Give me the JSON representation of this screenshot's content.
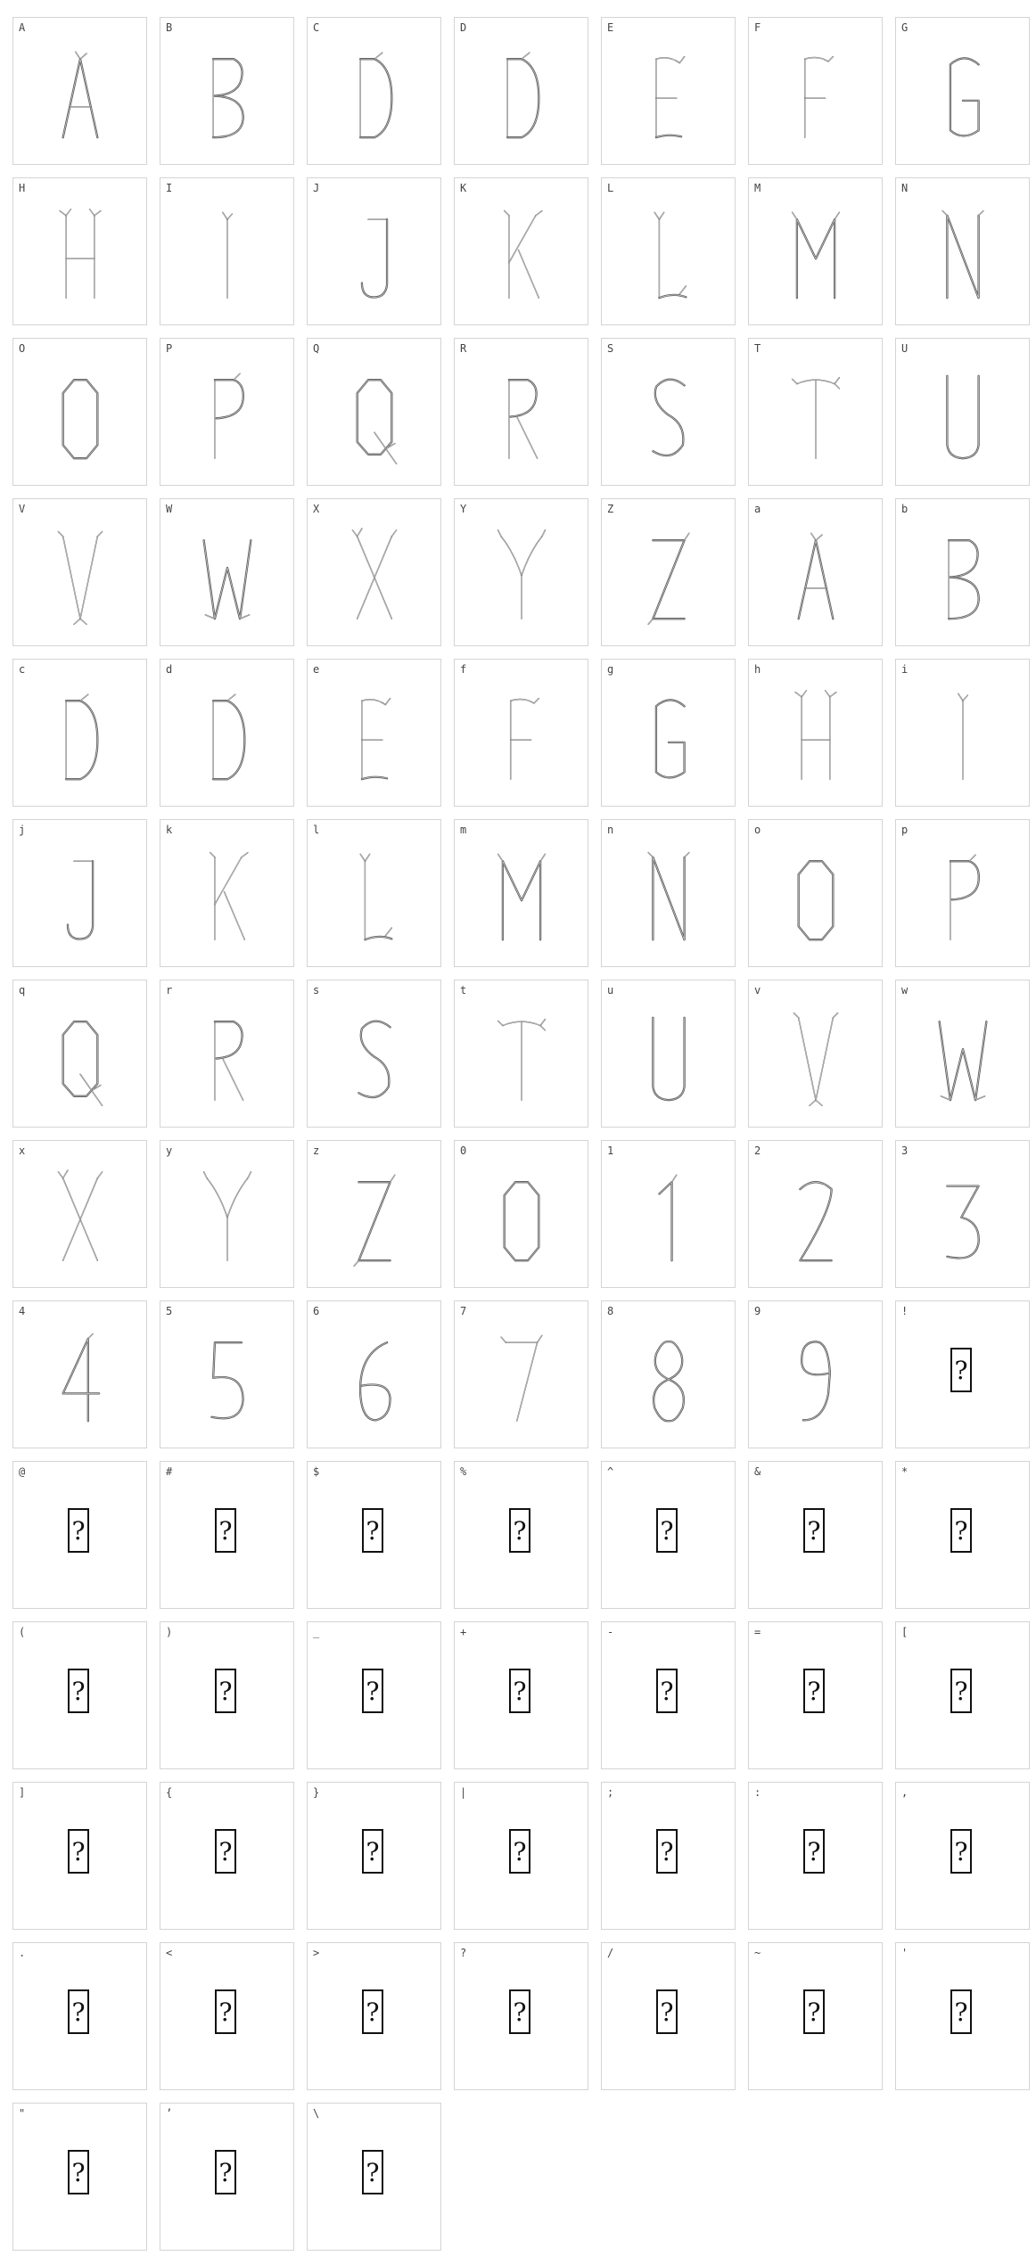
{
  "cells": [
    {
      "label": "A",
      "glyph": "A",
      "missing": false
    },
    {
      "label": "B",
      "glyph": "B",
      "missing": false
    },
    {
      "label": "C",
      "glyph": "D",
      "missing": false
    },
    {
      "label": "D",
      "glyph": "D",
      "missing": false
    },
    {
      "label": "E",
      "glyph": "E",
      "missing": false
    },
    {
      "label": "F",
      "glyph": "F",
      "missing": false
    },
    {
      "label": "G",
      "glyph": "G",
      "missing": false
    },
    {
      "label": "H",
      "glyph": "H",
      "missing": false
    },
    {
      "label": "I",
      "glyph": "I",
      "missing": false
    },
    {
      "label": "J",
      "glyph": "J",
      "missing": false
    },
    {
      "label": "K",
      "glyph": "K",
      "missing": false
    },
    {
      "label": "L",
      "glyph": "L",
      "missing": false
    },
    {
      "label": "M",
      "glyph": "M",
      "missing": false
    },
    {
      "label": "N",
      "glyph": "N",
      "missing": false
    },
    {
      "label": "O",
      "glyph": "O",
      "missing": false
    },
    {
      "label": "P",
      "glyph": "P",
      "missing": false
    },
    {
      "label": "Q",
      "glyph": "Q",
      "missing": false
    },
    {
      "label": "R",
      "glyph": "R",
      "missing": false
    },
    {
      "label": "S",
      "glyph": "S",
      "missing": false
    },
    {
      "label": "T",
      "glyph": "T",
      "missing": false
    },
    {
      "label": "U",
      "glyph": "U",
      "missing": false
    },
    {
      "label": "V",
      "glyph": "V",
      "missing": false
    },
    {
      "label": "W",
      "glyph": "W",
      "missing": false
    },
    {
      "label": "X",
      "glyph": "X",
      "missing": false
    },
    {
      "label": "Y",
      "glyph": "Y",
      "missing": false
    },
    {
      "label": "Z",
      "glyph": "Z",
      "missing": false
    },
    {
      "label": "a",
      "glyph": "A",
      "missing": false
    },
    {
      "label": "b",
      "glyph": "B",
      "missing": false
    },
    {
      "label": "c",
      "glyph": "D",
      "missing": false
    },
    {
      "label": "d",
      "glyph": "D",
      "missing": false
    },
    {
      "label": "e",
      "glyph": "E",
      "missing": false
    },
    {
      "label": "f",
      "glyph": "F",
      "missing": false
    },
    {
      "label": "g",
      "glyph": "G",
      "missing": false
    },
    {
      "label": "h",
      "glyph": "H",
      "missing": false
    },
    {
      "label": "i",
      "glyph": "I",
      "missing": false
    },
    {
      "label": "j",
      "glyph": "J",
      "missing": false
    },
    {
      "label": "k",
      "glyph": "K",
      "missing": false
    },
    {
      "label": "l",
      "glyph": "L",
      "missing": false
    },
    {
      "label": "m",
      "glyph": "M",
      "missing": false
    },
    {
      "label": "n",
      "glyph": "N",
      "missing": false
    },
    {
      "label": "o",
      "glyph": "O",
      "missing": false
    },
    {
      "label": "p",
      "glyph": "P",
      "missing": false
    },
    {
      "label": "q",
      "glyph": "Q",
      "missing": false
    },
    {
      "label": "r",
      "glyph": "R",
      "missing": false
    },
    {
      "label": "s",
      "glyph": "S",
      "missing": false
    },
    {
      "label": "t",
      "glyph": "T",
      "missing": false
    },
    {
      "label": "u",
      "glyph": "U",
      "missing": false
    },
    {
      "label": "v",
      "glyph": "V",
      "missing": false
    },
    {
      "label": "w",
      "glyph": "W",
      "missing": false
    },
    {
      "label": "x",
      "glyph": "X",
      "missing": false
    },
    {
      "label": "y",
      "glyph": "Y",
      "missing": false
    },
    {
      "label": "z",
      "glyph": "Z",
      "missing": false
    },
    {
      "label": "0",
      "glyph": "0",
      "missing": false
    },
    {
      "label": "1",
      "glyph": "1",
      "missing": false
    },
    {
      "label": "2",
      "glyph": "2",
      "missing": false
    },
    {
      "label": "3",
      "glyph": "3",
      "missing": false
    },
    {
      "label": "4",
      "glyph": "4",
      "missing": false
    },
    {
      "label": "5",
      "glyph": "5",
      "missing": false
    },
    {
      "label": "6",
      "glyph": "6",
      "missing": false
    },
    {
      "label": "7",
      "glyph": "7",
      "missing": false
    },
    {
      "label": "8",
      "glyph": "8",
      "missing": false
    },
    {
      "label": "9",
      "glyph": "9",
      "missing": false
    },
    {
      "label": "!",
      "glyph": "?",
      "missing": true
    },
    {
      "label": "@",
      "glyph": "?",
      "missing": true
    },
    {
      "label": "#",
      "glyph": "?",
      "missing": true
    },
    {
      "label": "$",
      "glyph": "?",
      "missing": true
    },
    {
      "label": "%",
      "glyph": "?",
      "missing": true
    },
    {
      "label": "^",
      "glyph": "?",
      "missing": true
    },
    {
      "label": "&",
      "glyph": "?",
      "missing": true
    },
    {
      "label": "*",
      "glyph": "?",
      "missing": true
    },
    {
      "label": "(",
      "glyph": "?",
      "missing": true
    },
    {
      "label": ")",
      "glyph": "?",
      "missing": true
    },
    {
      "label": "_",
      "glyph": "?",
      "missing": true
    },
    {
      "label": "+",
      "glyph": "?",
      "missing": true
    },
    {
      "label": "-",
      "glyph": "?",
      "missing": true
    },
    {
      "label": "=",
      "glyph": "?",
      "missing": true
    },
    {
      "label": "[",
      "glyph": "?",
      "missing": true
    },
    {
      "label": "]",
      "glyph": "?",
      "missing": true
    },
    {
      "label": "{",
      "glyph": "?",
      "missing": true
    },
    {
      "label": "}",
      "glyph": "?",
      "missing": true
    },
    {
      "label": "|",
      "glyph": "?",
      "missing": true
    },
    {
      "label": ";",
      "glyph": "?",
      "missing": true
    },
    {
      "label": ":",
      "glyph": "?",
      "missing": true
    },
    {
      "label": ",",
      "glyph": "?",
      "missing": true
    },
    {
      "label": ".",
      "glyph": "?",
      "missing": true
    },
    {
      "label": "<",
      "glyph": "?",
      "missing": true
    },
    {
      "label": ">",
      "glyph": "?",
      "missing": true
    },
    {
      "label": "?",
      "glyph": "?",
      "missing": true
    },
    {
      "label": "/",
      "glyph": "?",
      "missing": true
    },
    {
      "label": "~",
      "glyph": "?",
      "missing": true
    },
    {
      "label": "'",
      "glyph": "?",
      "missing": true
    },
    {
      "label": "\"",
      "glyph": "?",
      "missing": true
    },
    {
      "label": "’",
      "glyph": "?",
      "missing": true
    },
    {
      "label": "\\",
      "glyph": "?",
      "missing": true
    }
  ]
}
